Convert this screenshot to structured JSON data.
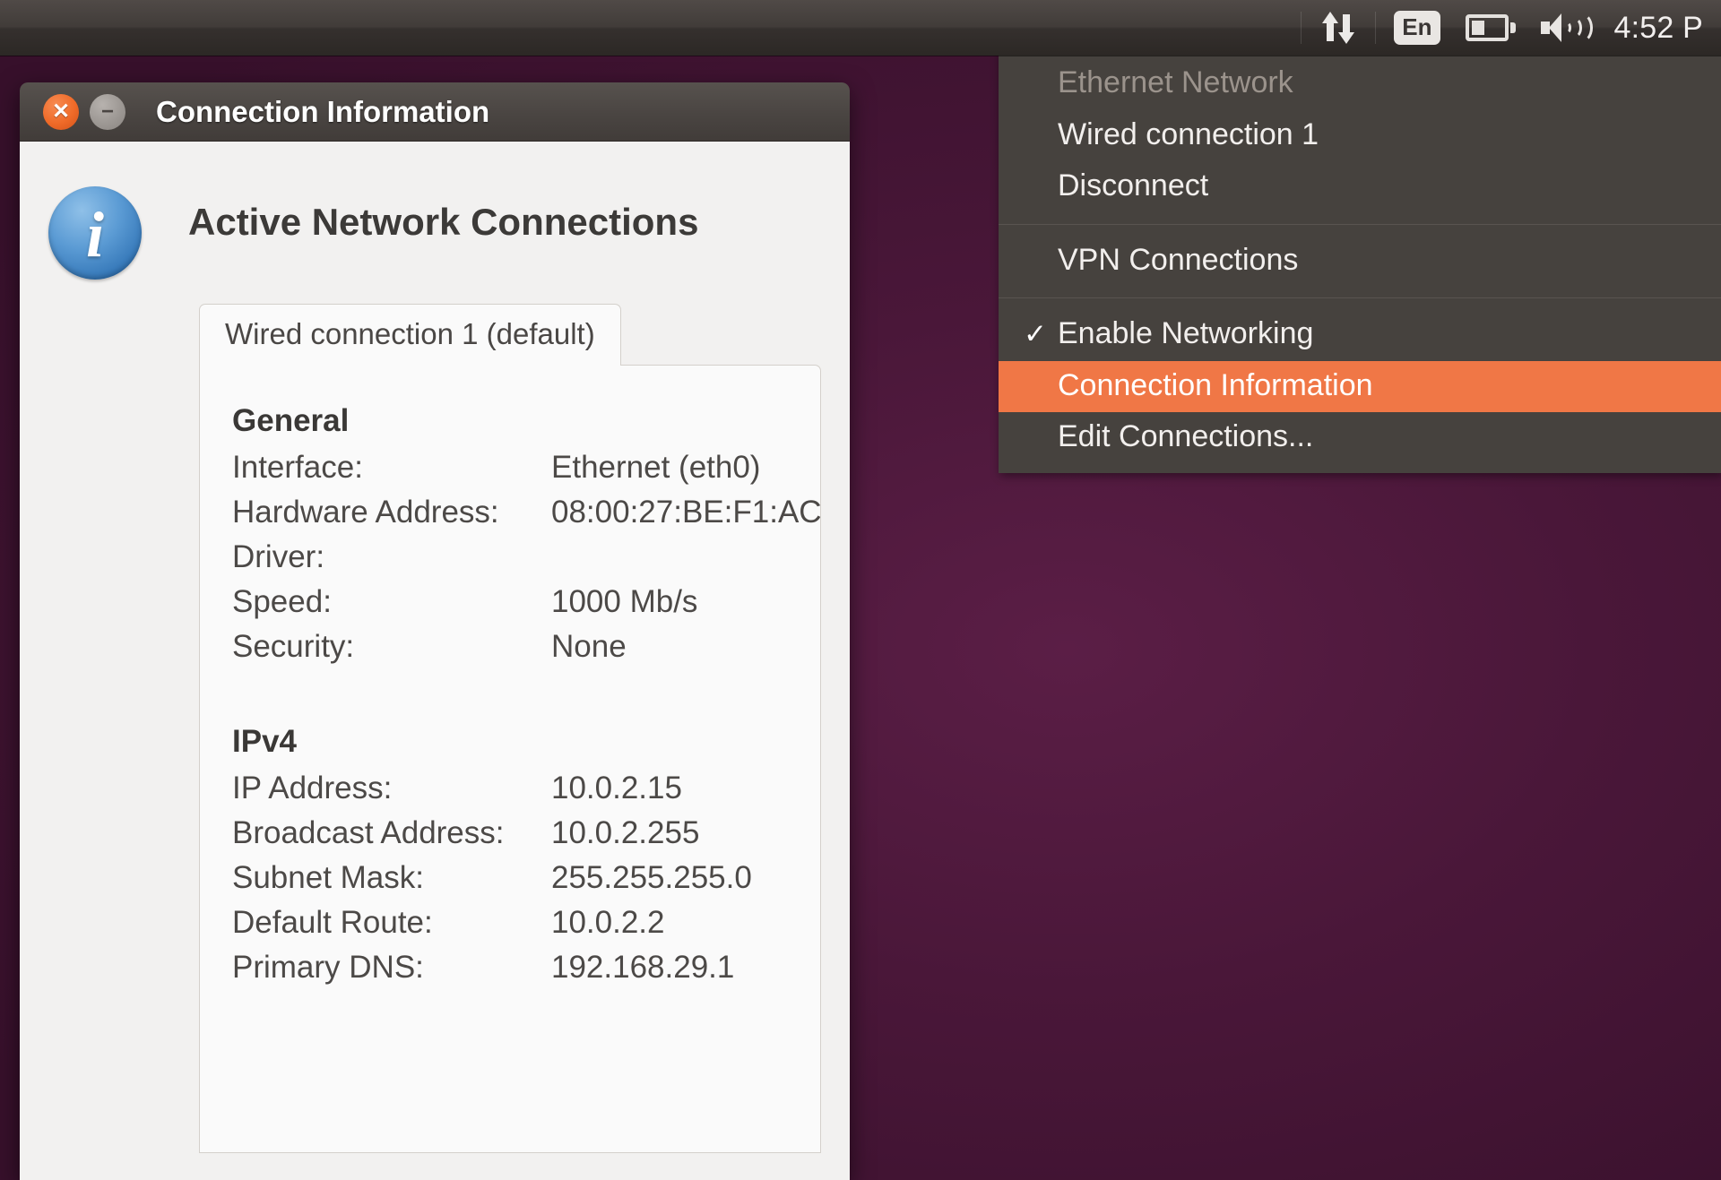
{
  "panel": {
    "network_icon": "network-arrows-icon",
    "keyboard_layout": "En",
    "battery_icon": "battery-icon",
    "volume_icon": "volume-icon",
    "clock": "4:52 P"
  },
  "network_menu": {
    "items": [
      {
        "label": "Ethernet Network",
        "type": "header"
      },
      {
        "label": "Wired connection 1",
        "type": "item"
      },
      {
        "label": "Disconnect",
        "type": "item"
      },
      {
        "label": "",
        "type": "separator"
      },
      {
        "label": "VPN Connections",
        "type": "item"
      },
      {
        "label": "",
        "type": "separator"
      },
      {
        "label": "Enable Networking",
        "type": "checkbox",
        "checked": true
      },
      {
        "label": "Connection Information",
        "type": "item",
        "highlighted": true
      },
      {
        "label": "Edit Connections...",
        "type": "item"
      }
    ],
    "check_glyph": "✓",
    "highlight_color": "#f07746"
  },
  "dialog": {
    "title": "Connection Information",
    "close_glyph": "✕",
    "minimize_glyph": "−",
    "info_glyph": "i",
    "heading": "Active Network Connections",
    "tabs": [
      {
        "label": "Wired connection 1 (default)",
        "active": true
      }
    ],
    "sections": [
      {
        "title": "General",
        "rows": [
          {
            "key": "Interface:",
            "value": "Ethernet (eth0)"
          },
          {
            "key": "Hardware Address:",
            "value": "08:00:27:BE:F1:AC"
          },
          {
            "key": "Driver:",
            "value": ""
          },
          {
            "key": "Speed:",
            "value": "1000 Mb/s"
          },
          {
            "key": "Security:",
            "value": "None"
          }
        ]
      },
      {
        "title": "IPv4",
        "rows": [
          {
            "key": "IP Address:",
            "value": "10.0.2.15"
          },
          {
            "key": "Broadcast Address:",
            "value": "10.0.2.255"
          },
          {
            "key": "Subnet Mask:",
            "value": "255.255.255.0"
          },
          {
            "key": "Default Route:",
            "value": "10.0.2.2"
          },
          {
            "key": "Primary DNS:",
            "value": "192.168.29.1"
          }
        ]
      }
    ]
  }
}
